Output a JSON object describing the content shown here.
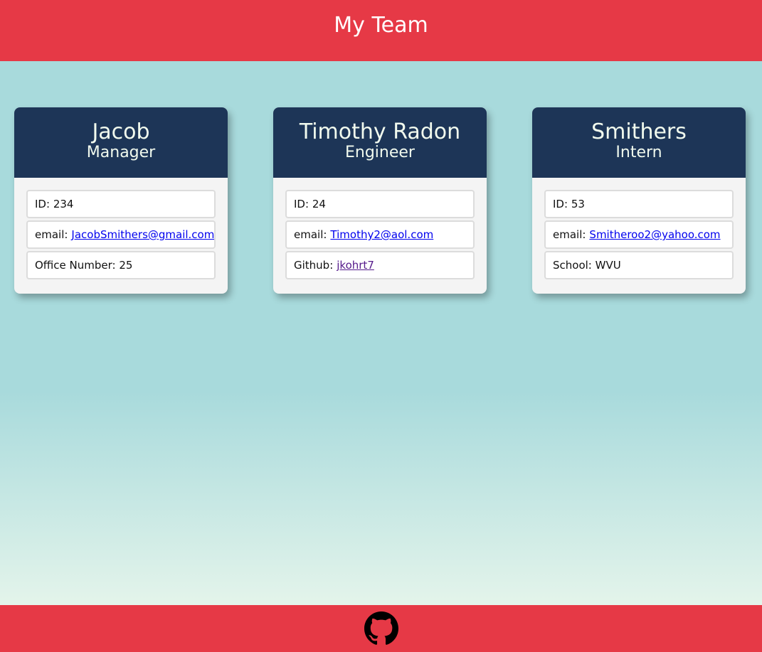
{
  "header": {
    "title": "My Team"
  },
  "employees": [
    {
      "name": "Jacob",
      "role": "Manager",
      "id_label": "ID:",
      "id": "234",
      "email_label": "email:",
      "email": "JacobSmithers@gmail.com",
      "extra_label": "Office Number:",
      "extra_value": "25"
    },
    {
      "name": "Timothy Radon",
      "role": "Engineer",
      "id_label": "ID:",
      "id": "24",
      "email_label": "email:",
      "email": "Timothy2@aol.com",
      "extra_label": "Github:",
      "extra_value": "jkohrt7"
    },
    {
      "name": "Smithers",
      "role": "Intern",
      "id_label": "ID:",
      "id": "53",
      "email_label": "email:",
      "email": "Smitheroo2@yahoo.com",
      "extra_label": "School:",
      "extra_value": "WVU"
    }
  ],
  "footer": {
    "icon": "github-icon"
  },
  "colors": {
    "header_bg": "#e63946",
    "card_head_bg": "#1d3557",
    "page_bg_top": "#a8dadc",
    "page_bg_bottom": "#f1faee",
    "link": "#0000ee",
    "link_visited": "#551a8b"
  }
}
